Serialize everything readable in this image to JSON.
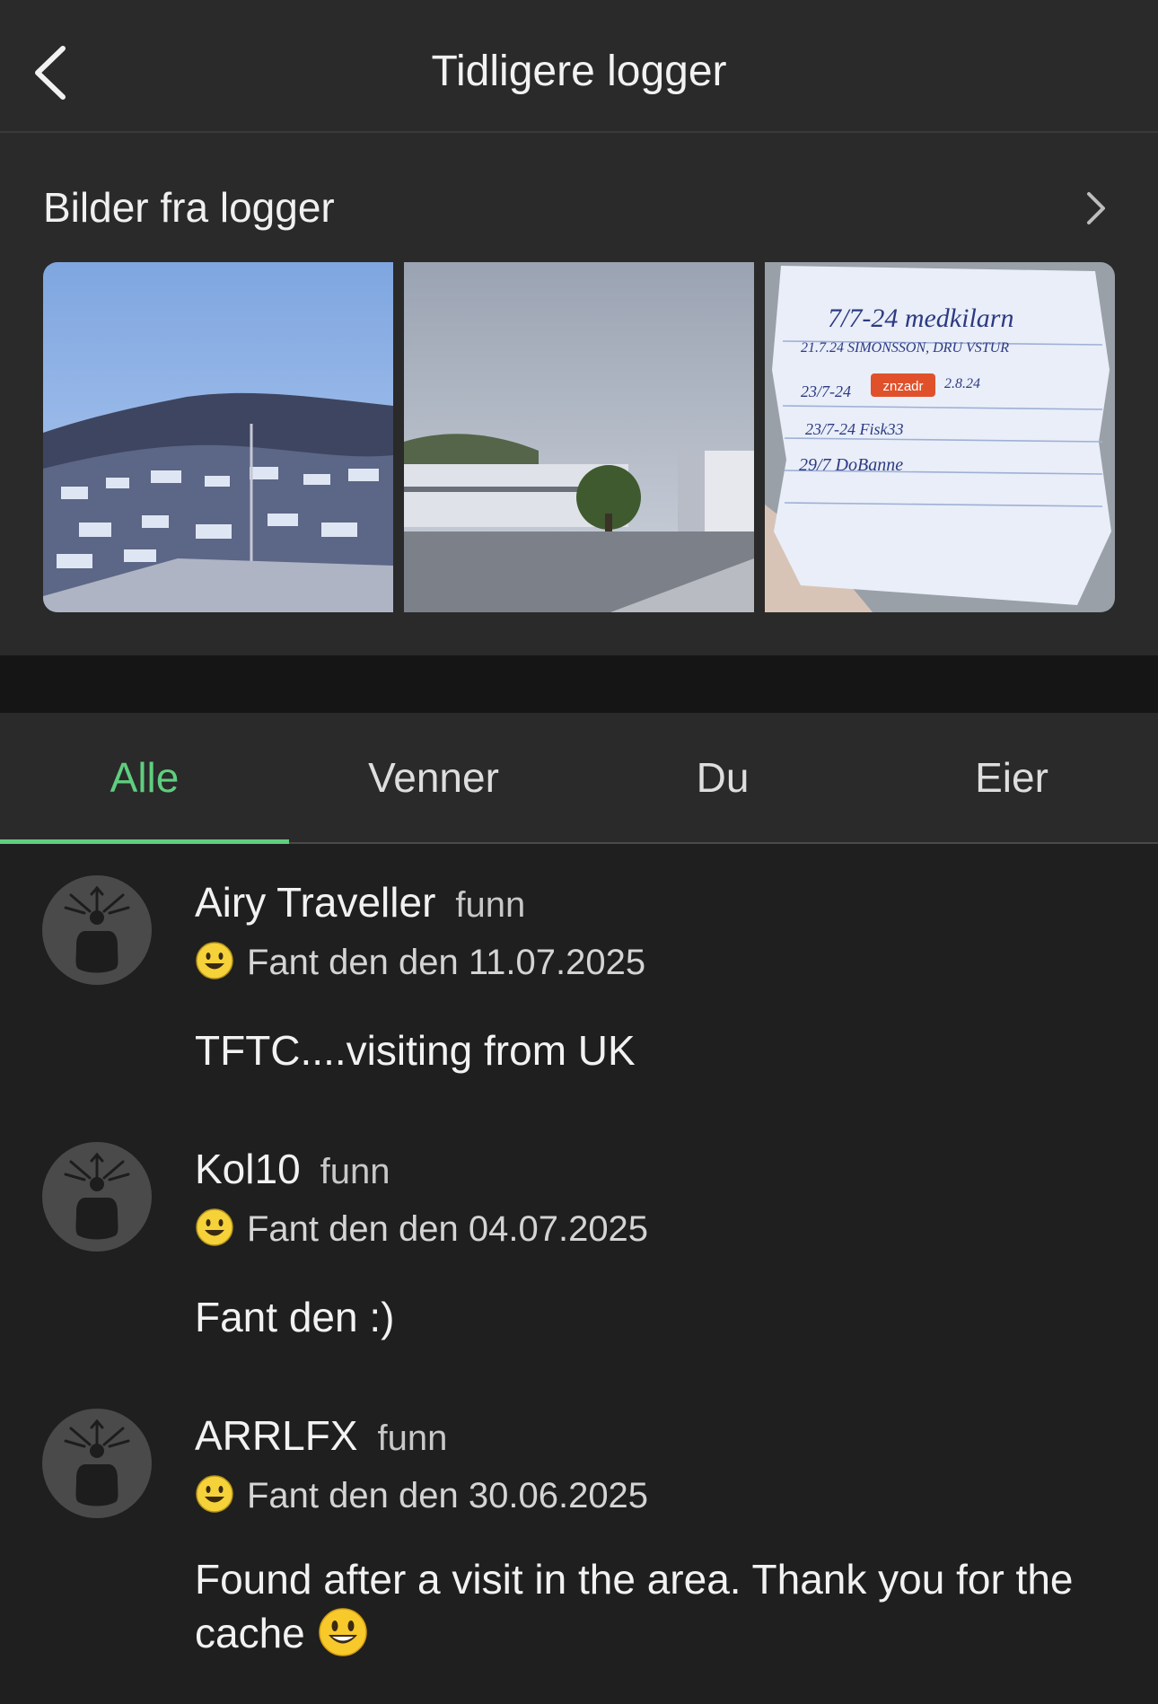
{
  "header": {
    "title": "Tidligere logger",
    "back_icon": "chevron-left-icon"
  },
  "photos": {
    "title": "Bilder fra logger",
    "more_icon": "chevron-right-icon",
    "items": [
      {
        "name": "snowy-hillside-photo"
      },
      {
        "name": "industrial-building-photo"
      },
      {
        "name": "logbook-paper-photo",
        "visible_text": [
          "7/7-24 medkilarn",
          "21.7.24 SIMONSSON, DRU VSTUR",
          "23/7-24",
          "znzadr",
          "2.8.24",
          "23/7-24 Fisk33",
          "29/7 DoBanne"
        ]
      }
    ]
  },
  "tabs": [
    {
      "label": "Alle",
      "active": true
    },
    {
      "label": "Venner",
      "active": false
    },
    {
      "label": "Du",
      "active": false
    },
    {
      "label": "Eier",
      "active": false
    }
  ],
  "logs": [
    {
      "user": "Airy Traveller",
      "type": "funn",
      "status": "Fant den den 11.07.2025",
      "text": "TFTC....visiting from UK"
    },
    {
      "user": "Kol10",
      "type": "funn",
      "status": "Fant den den 04.07.2025",
      "text": "Fant den :)"
    },
    {
      "user": "ARRLFX",
      "type": "funn",
      "status": "Fant den den 30.06.2025",
      "text": "Found after a visit in the area. Thank you for the cache"
    }
  ],
  "colors": {
    "accent": "#5fce7f",
    "background": "#1f1f1f",
    "header": "#2a2a2a"
  }
}
